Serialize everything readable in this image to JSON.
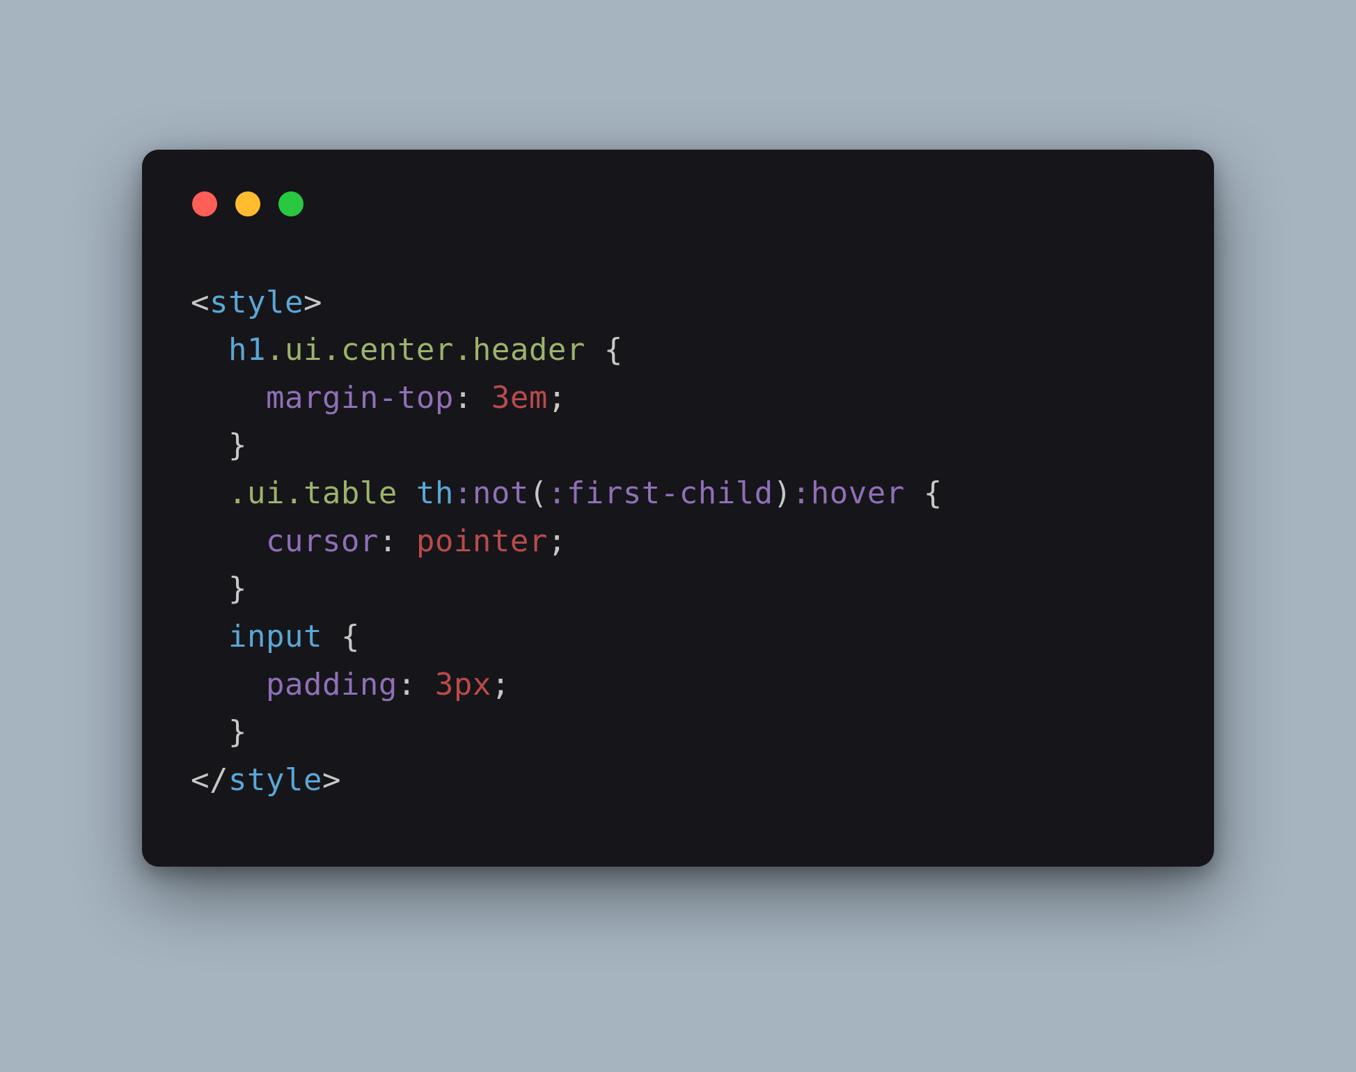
{
  "window_controls": {
    "close": "close",
    "minimize": "minimize",
    "maximize": "maximize"
  },
  "code": {
    "open_angle": "<",
    "close_angle": ">",
    "slash": "/",
    "tag_style": "style",
    "selector1": {
      "tag": "h1",
      "classes": ".ui.center.header"
    },
    "rule1": {
      "prop": "margin-top",
      "value": "3em"
    },
    "selector2": {
      "classes": ".ui.table",
      "space": " ",
      "tag": "th",
      "pseudo_not": ":not",
      "paren_open": "(",
      "first_child": ":first-child",
      "paren_close": ")",
      "pseudo_hover": ":hover"
    },
    "rule2": {
      "prop": "cursor",
      "value": "pointer"
    },
    "selector3": {
      "tag": "input"
    },
    "rule3": {
      "prop": "padding",
      "value": "3px"
    },
    "brace_open": "{",
    "brace_close": "}",
    "colon": ":",
    "semicolon": ";",
    "indent1": "  ",
    "indent2": "    "
  }
}
